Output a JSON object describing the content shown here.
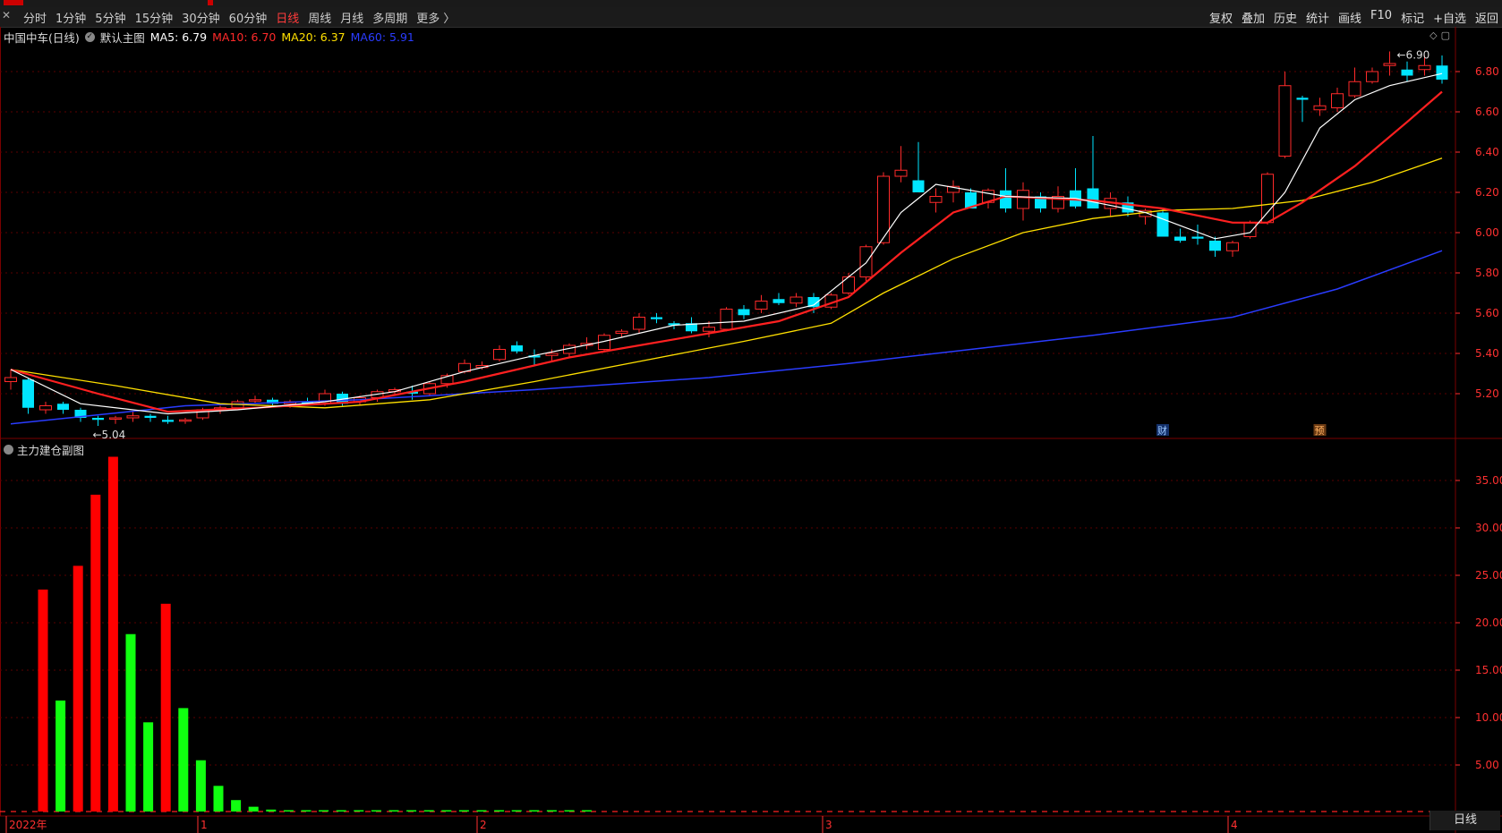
{
  "toolbar": {
    "close_glyph": "✕",
    "periods": [
      "分时",
      "1分钟",
      "5分钟",
      "15分钟",
      "30分钟",
      "60分钟",
      "日线",
      "周线",
      "月线",
      "多周期",
      "更多 〉"
    ],
    "active_period": "日线",
    "actions": [
      "复权",
      "叠加",
      "历史",
      "统计",
      "画线",
      "F10",
      "标记",
      "+自选",
      "返回"
    ]
  },
  "main_panel": {
    "stock_label": "中国中车(日线)",
    "template_label": "默认主图",
    "ma5": "MA5: 6.79",
    "ma10": "MA10: 6.70",
    "ma20": "MA20: 6.37",
    "ma60": "MA60: 5.91",
    "high_marker": "6.90",
    "low_marker": "5.04",
    "event_badges": [
      "财",
      "预"
    ],
    "y_ticks": [
      "6.80",
      "6.60",
      "6.40",
      "6.20",
      "6.00",
      "5.80",
      "5.60",
      "5.40",
      "5.20"
    ]
  },
  "sub_panel": {
    "title": "主力建仓副图",
    "y_ticks": [
      "35.00",
      "30.00",
      "25.00",
      "20.00",
      "15.00",
      "10.00",
      "5.00"
    ]
  },
  "date_axis": {
    "labels": [
      "2022年",
      "1",
      "2",
      "3",
      "4"
    ],
    "period_badge": "日线"
  },
  "colors": {
    "up": "#ff2a2a",
    "down": "#00e5ff",
    "ma5": "#ffffff",
    "ma10": "#ff2020",
    "ma20": "#ffe000",
    "ma60": "#2a3cff",
    "bar_red": "#ff0000",
    "bar_green": "#10ff10",
    "grid": "#5a0000"
  },
  "chart_data": {
    "type": "bar",
    "price_ylim": [
      5.0,
      6.9
    ],
    "candles": [
      [
        5.26,
        5.32,
        5.22,
        5.28
      ],
      [
        5.27,
        5.28,
        5.1,
        5.13
      ],
      [
        5.12,
        5.16,
        5.1,
        5.14
      ],
      [
        5.15,
        5.16,
        5.1,
        5.12
      ],
      [
        5.12,
        5.13,
        5.06,
        5.08
      ],
      [
        5.08,
        5.09,
        5.04,
        5.07
      ],
      [
        5.08,
        5.09,
        5.05,
        5.08
      ],
      [
        5.08,
        5.11,
        5.06,
        5.09
      ],
      [
        5.09,
        5.1,
        5.06,
        5.08
      ],
      [
        5.07,
        5.09,
        5.05,
        5.06
      ],
      [
        5.07,
        5.08,
        5.05,
        5.07
      ],
      [
        5.08,
        5.13,
        5.07,
        5.12
      ],
      [
        5.12,
        5.14,
        5.1,
        5.13
      ],
      [
        5.13,
        5.17,
        5.12,
        5.16
      ],
      [
        5.17,
        5.19,
        5.15,
        5.17
      ],
      [
        5.17,
        5.18,
        5.14,
        5.15
      ],
      [
        5.15,
        5.17,
        5.13,
        5.16
      ],
      [
        5.16,
        5.18,
        5.14,
        5.15
      ],
      [
        5.15,
        5.22,
        5.14,
        5.2
      ],
      [
        5.2,
        5.21,
        5.14,
        5.15
      ],
      [
        5.16,
        5.19,
        5.14,
        5.18
      ],
      [
        5.18,
        5.22,
        5.16,
        5.21
      ],
      [
        5.21,
        5.23,
        5.19,
        5.22
      ],
      [
        5.21,
        5.24,
        5.17,
        5.2
      ],
      [
        5.2,
        5.26,
        5.19,
        5.25
      ],
      [
        5.25,
        5.3,
        5.23,
        5.29
      ],
      [
        5.31,
        5.37,
        5.3,
        5.35
      ],
      [
        5.33,
        5.36,
        5.32,
        5.34
      ],
      [
        5.37,
        5.44,
        5.36,
        5.42
      ],
      [
        5.44,
        5.46,
        5.4,
        5.41
      ],
      [
        5.39,
        5.42,
        5.34,
        5.38
      ],
      [
        5.39,
        5.42,
        5.36,
        5.4
      ],
      [
        5.4,
        5.45,
        5.38,
        5.44
      ],
      [
        5.44,
        5.48,
        5.42,
        5.45
      ],
      [
        5.42,
        5.5,
        5.41,
        5.49
      ],
      [
        5.5,
        5.52,
        5.48,
        5.51
      ],
      [
        5.52,
        5.6,
        5.5,
        5.58
      ],
      [
        5.58,
        5.6,
        5.55,
        5.57
      ],
      [
        5.55,
        5.56,
        5.52,
        5.54
      ],
      [
        5.55,
        5.58,
        5.5,
        5.51
      ],
      [
        5.51,
        5.56,
        5.48,
        5.53
      ],
      [
        5.52,
        5.63,
        5.51,
        5.62
      ],
      [
        5.62,
        5.64,
        5.57,
        5.59
      ],
      [
        5.62,
        5.69,
        5.6,
        5.66
      ],
      [
        5.67,
        5.7,
        5.64,
        5.65
      ],
      [
        5.65,
        5.7,
        5.63,
        5.68
      ],
      [
        5.68,
        5.7,
        5.6,
        5.63
      ],
      [
        5.63,
        5.7,
        5.62,
        5.69
      ],
      [
        5.7,
        5.8,
        5.69,
        5.78
      ],
      [
        5.78,
        5.94,
        5.76,
        5.93
      ],
      [
        5.95,
        6.3,
        5.94,
        6.28
      ],
      [
        6.28,
        6.43,
        6.25,
        6.31
      ],
      [
        6.26,
        6.45,
        6.2,
        6.2
      ],
      [
        6.15,
        6.22,
        6.1,
        6.18
      ],
      [
        6.2,
        6.26,
        6.15,
        6.23
      ],
      [
        6.2,
        6.22,
        6.12,
        6.12
      ],
      [
        6.15,
        6.22,
        6.12,
        6.21
      ],
      [
        6.21,
        6.32,
        6.1,
        6.12
      ],
      [
        6.12,
        6.25,
        6.06,
        6.21
      ],
      [
        6.18,
        6.2,
        6.1,
        6.12
      ],
      [
        6.12,
        6.23,
        6.1,
        6.18
      ],
      [
        6.21,
        6.32,
        6.12,
        6.13
      ],
      [
        6.22,
        6.48,
        6.12,
        6.12
      ],
      [
        6.12,
        6.2,
        6.08,
        6.17
      ],
      [
        6.15,
        6.18,
        6.08,
        6.1
      ],
      [
        6.08,
        6.12,
        6.04,
        6.11
      ],
      [
        6.1,
        6.12,
        5.98,
        5.98
      ],
      [
        5.98,
        6.02,
        5.95,
        5.96
      ],
      [
        5.98,
        6.04,
        5.94,
        5.97
      ],
      [
        5.96,
        5.98,
        5.88,
        5.91
      ],
      [
        5.91,
        5.96,
        5.88,
        5.95
      ],
      [
        5.98,
        6.06,
        5.97,
        6.05
      ],
      [
        6.05,
        6.3,
        6.04,
        6.29
      ],
      [
        6.38,
        6.8,
        6.37,
        6.73
      ],
      [
        6.67,
        6.68,
        6.55,
        6.66
      ],
      [
        6.61,
        6.67,
        6.58,
        6.63
      ],
      [
        6.62,
        6.72,
        6.6,
        6.69
      ],
      [
        6.68,
        6.82,
        6.67,
        6.75
      ],
      [
        6.75,
        6.82,
        6.74,
        6.8
      ],
      [
        6.83,
        6.9,
        6.78,
        6.84
      ],
      [
        6.81,
        6.85,
        6.75,
        6.78
      ],
      [
        6.81,
        6.88,
        6.78,
        6.83
      ],
      [
        6.83,
        6.88,
        6.74,
        6.76
      ]
    ],
    "ma5_line": [
      [
        0,
        5.32
      ],
      [
        4,
        5.15
      ],
      [
        9,
        5.1
      ],
      [
        13,
        5.12
      ],
      [
        18,
        5.16
      ],
      [
        22,
        5.21
      ],
      [
        26,
        5.31
      ],
      [
        30,
        5.39
      ],
      [
        34,
        5.46
      ],
      [
        38,
        5.54
      ],
      [
        42,
        5.56
      ],
      [
        46,
        5.64
      ],
      [
        49,
        5.85
      ],
      [
        51,
        6.1
      ],
      [
        53,
        6.24
      ],
      [
        57,
        6.18
      ],
      [
        61,
        6.17
      ],
      [
        65,
        6.1
      ],
      [
        69,
        5.97
      ],
      [
        71,
        6.0
      ],
      [
        73,
        6.2
      ],
      [
        75,
        6.52
      ],
      [
        77,
        6.66
      ],
      [
        79,
        6.73
      ],
      [
        82,
        6.79
      ]
    ],
    "ma10_line": [
      [
        0,
        5.32
      ],
      [
        5,
        5.2
      ],
      [
        9,
        5.11
      ],
      [
        14,
        5.13
      ],
      [
        20,
        5.16
      ],
      [
        26,
        5.26
      ],
      [
        32,
        5.38
      ],
      [
        38,
        5.47
      ],
      [
        44,
        5.56
      ],
      [
        48,
        5.68
      ],
      [
        51,
        5.9
      ],
      [
        54,
        6.1
      ],
      [
        57,
        6.18
      ],
      [
        62,
        6.16
      ],
      [
        66,
        6.12
      ],
      [
        70,
        6.05
      ],
      [
        72,
        6.05
      ],
      [
        74,
        6.15
      ],
      [
        77,
        6.33
      ],
      [
        80,
        6.55
      ],
      [
        82,
        6.7
      ]
    ],
    "ma20_line": [
      [
        0,
        5.32
      ],
      [
        6,
        5.24
      ],
      [
        12,
        5.15
      ],
      [
        18,
        5.13
      ],
      [
        24,
        5.17
      ],
      [
        30,
        5.26
      ],
      [
        36,
        5.36
      ],
      [
        42,
        5.46
      ],
      [
        47,
        5.55
      ],
      [
        50,
        5.7
      ],
      [
        54,
        5.87
      ],
      [
        58,
        6.0
      ],
      [
        62,
        6.07
      ],
      [
        66,
        6.11
      ],
      [
        70,
        6.12
      ],
      [
        74,
        6.16
      ],
      [
        78,
        6.25
      ],
      [
        82,
        6.37
      ]
    ],
    "ma60_line": [
      [
        0,
        5.05
      ],
      [
        10,
        5.14
      ],
      [
        20,
        5.17
      ],
      [
        30,
        5.22
      ],
      [
        40,
        5.28
      ],
      [
        48,
        5.35
      ],
      [
        54,
        5.41
      ],
      [
        62,
        5.49
      ],
      [
        70,
        5.58
      ],
      [
        76,
        5.72
      ],
      [
        82,
        5.91
      ]
    ],
    "sub_ylim": [
      0,
      40
    ],
    "volume_bars": [
      23.5,
      11.8,
      26,
      33.5,
      37.5,
      18.8,
      9.5,
      22,
      11,
      5.5,
      2.8,
      1.3,
      0.6,
      0.3,
      0.15,
      0.1,
      0.08,
      0.06,
      0.05,
      0.05,
      0.04,
      0.04,
      0.04,
      0.04,
      0.04,
      0.04,
      0.04,
      0.04,
      0.04,
      0.04,
      0.04,
      0.04
    ],
    "volume_colors": [
      "red",
      "green",
      "red",
      "red",
      "red",
      "green",
      "green",
      "red",
      "green",
      "green",
      "green",
      "green",
      "green",
      "green",
      "green",
      "green",
      "green",
      "green",
      "green",
      "green",
      "green",
      "green",
      "green",
      "green",
      "green",
      "green",
      "green",
      "green",
      "green",
      "green",
      "green",
      "green"
    ]
  }
}
